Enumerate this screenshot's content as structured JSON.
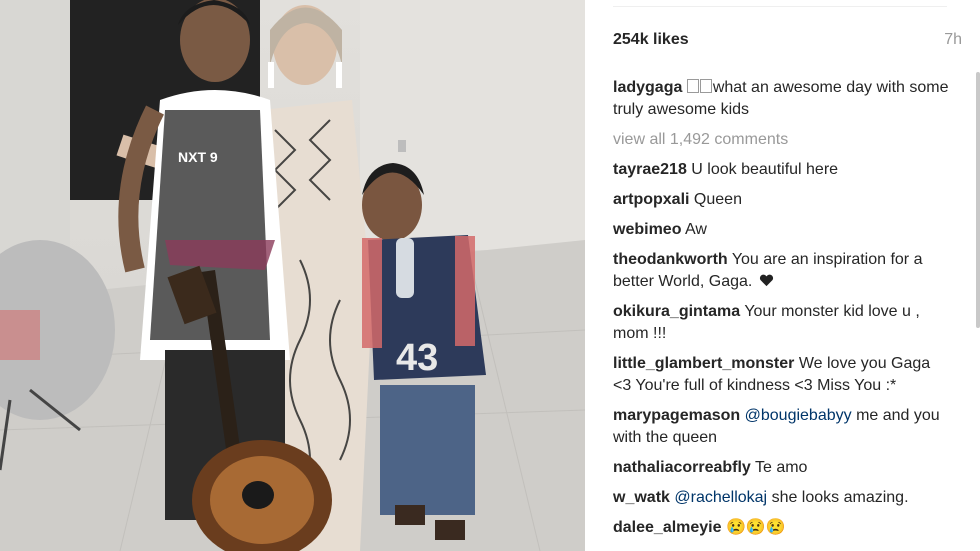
{
  "post": {
    "likes": "254k likes",
    "time": "7h",
    "caption": {
      "user": "ladygaga",
      "text": "what an awesome day with some truly awesome kids"
    },
    "view_all": "view all 1,492 comments",
    "comments": [
      {
        "user": "tayrae218",
        "text": "U look beautiful here"
      },
      {
        "user": "artpopxali",
        "text": "Queen"
      },
      {
        "user": "webimeo",
        "text": "Aw"
      },
      {
        "user": "theodankworth",
        "text": "You are an inspiration for a better World, Gaga."
      },
      {
        "user": "okikura_gintama",
        "text": "Your monster kid love u , mom !!!"
      },
      {
        "user": "little_glambert_monster",
        "text": "We love you Gaga <3 You're full of kindness <3 Miss You :*"
      },
      {
        "user": "marypagemason",
        "mention": "@bougiebabyy",
        "text": "me and you with the queen"
      },
      {
        "user": "nathaliacorreabfly",
        "text": "Te amo"
      },
      {
        "user": "w_watk",
        "mention": "@rachellokaj",
        "text": "she looks amazing."
      },
      {
        "user": "dalee_almeyie",
        "text": ""
      }
    ]
  },
  "photo": {
    "shirt_number": "43",
    "shirt_text": "NXT 9"
  }
}
